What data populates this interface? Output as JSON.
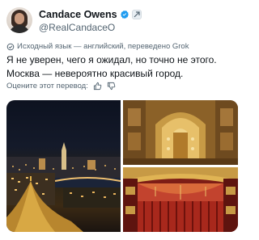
{
  "author": {
    "name": "Candace Owens",
    "handle": "@RealCandaceO"
  },
  "translation_note": "Исходный язык — английский, переведено Grok",
  "tweet": {
    "lines": [
      "Я не уверен, чего я ожидал, но точно не этого.",
      "Москва — невероятно красивый город."
    ]
  },
  "rate_prompt": "Оцените этот перевод:",
  "icons": [
    "verified-icon",
    "grok-badge-icon",
    "translate-icon",
    "thumbs-up-icon",
    "thumbs-down-icon"
  ],
  "colors": {
    "verified": "#1d9bf0",
    "secondary_text": "#536471",
    "primary_text": "#0f1419"
  },
  "media": [
    {
      "name": "moscow-night-panorama"
    },
    {
      "name": "cathedral-interior-dome"
    },
    {
      "name": "theatre-stage-curtain"
    }
  ]
}
